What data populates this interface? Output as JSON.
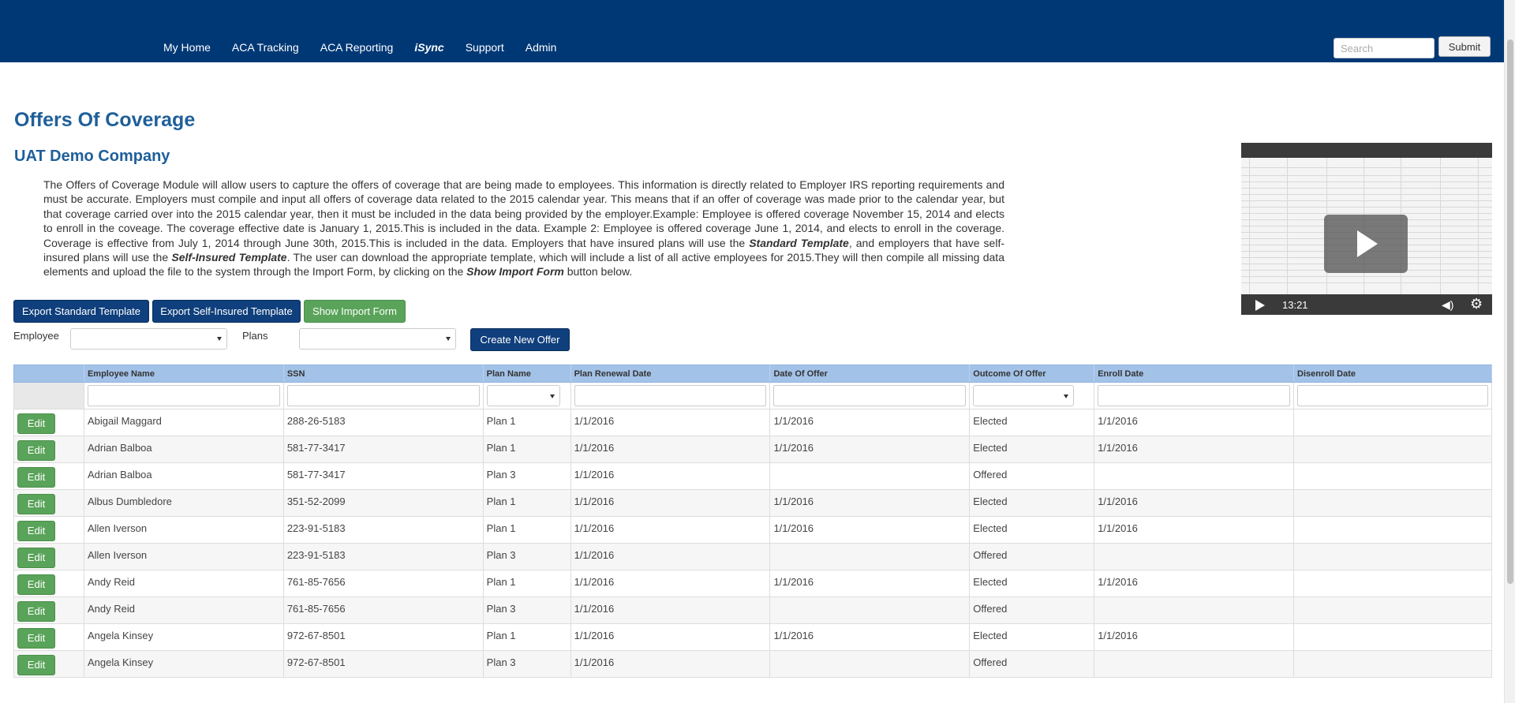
{
  "nav": {
    "items": [
      "My Home",
      "ACA Tracking",
      "ACA Reporting",
      "iSync",
      "Support",
      "Admin"
    ],
    "search_placeholder": "Search",
    "submit_label": "Submit"
  },
  "page": {
    "title": "Offers Of Coverage",
    "company": "UAT Demo Company",
    "description_parts": {
      "p1": "The Offers of Coverage Module will allow users to capture the offers of coverage that are being made to employees. This information is directly related to Employer IRS reporting requirements and must be accurate. Employers must compile and input all offers of coverage data related to the 2015 calendar year. This means that if an offer of coverage was made prior to the calendar year, but that coverage carried over into the 2015 calendar year, then it must be included in the data being provided by the employer.Example: Employee is offered coverage November 15, 2014 and elects to enroll in the coveage. The coverage effective date is January 1, 2015.This is included in the data. Example 2: Employee is offered coverage June 1, 2014, and elects to enroll in the coverage. Coverage is effective from July 1, 2014 through June 30th, 2015.This is included in the data. Employers that have insured plans will use the ",
      "b1": "Standard Template",
      "p2": ", and employers that have self-insured plans will use the ",
      "b2": "Self-Insured Template",
      "p3": ". The user can download the appropriate template, which will include a list of all active employees for 2015.They will then compile all missing data elements and upload the file to the system through the Import Form, by clicking on the ",
      "b3": "Show Import Form",
      "p4": " button below."
    }
  },
  "video": {
    "time": "13:21"
  },
  "actions": {
    "export_standard": "Export Standard Template",
    "export_self_insured": "Export Self-Insured Template",
    "show_import": "Show Import Form",
    "create_offer": "Create New Offer"
  },
  "filters": {
    "employee_label": "Employee",
    "plans_label": "Plans"
  },
  "table": {
    "columns": [
      "Employee Name",
      "SSN",
      "Plan Name",
      "Plan Renewal Date",
      "Date Of Offer",
      "Outcome Of Offer",
      "Enroll Date",
      "Disenroll Date"
    ],
    "edit_label": "Edit",
    "rows": [
      [
        "Abigail Maggard",
        "288-26-5183",
        "Plan 1",
        "1/1/2016",
        "1/1/2016",
        "Elected",
        "1/1/2016",
        ""
      ],
      [
        "Adrian Balboa",
        "581-77-3417",
        "Plan 1",
        "1/1/2016",
        "1/1/2016",
        "Elected",
        "1/1/2016",
        ""
      ],
      [
        "Adrian Balboa",
        "581-77-3417",
        "Plan 3",
        "1/1/2016",
        "",
        "Offered",
        "",
        ""
      ],
      [
        "Albus Dumbledore",
        "351-52-2099",
        "Plan 1",
        "1/1/2016",
        "1/1/2016",
        "Elected",
        "1/1/2016",
        ""
      ],
      [
        "Allen Iverson",
        "223-91-5183",
        "Plan 1",
        "1/1/2016",
        "1/1/2016",
        "Elected",
        "1/1/2016",
        ""
      ],
      [
        "Allen Iverson",
        "223-91-5183",
        "Plan 3",
        "1/1/2016",
        "",
        "Offered",
        "",
        ""
      ],
      [
        "Andy Reid",
        "761-85-7656",
        "Plan 1",
        "1/1/2016",
        "1/1/2016",
        "Elected",
        "1/1/2016",
        ""
      ],
      [
        "Andy Reid",
        "761-85-7656",
        "Plan 3",
        "1/1/2016",
        "",
        "Offered",
        "",
        ""
      ],
      [
        "Angela Kinsey",
        "972-67-8501",
        "Plan 1",
        "1/1/2016",
        "1/1/2016",
        "Elected",
        "1/1/2016",
        ""
      ],
      [
        "Angela Kinsey",
        "972-67-8501",
        "Plan 3",
        "1/1/2016",
        "",
        "Offered",
        "",
        ""
      ]
    ]
  }
}
